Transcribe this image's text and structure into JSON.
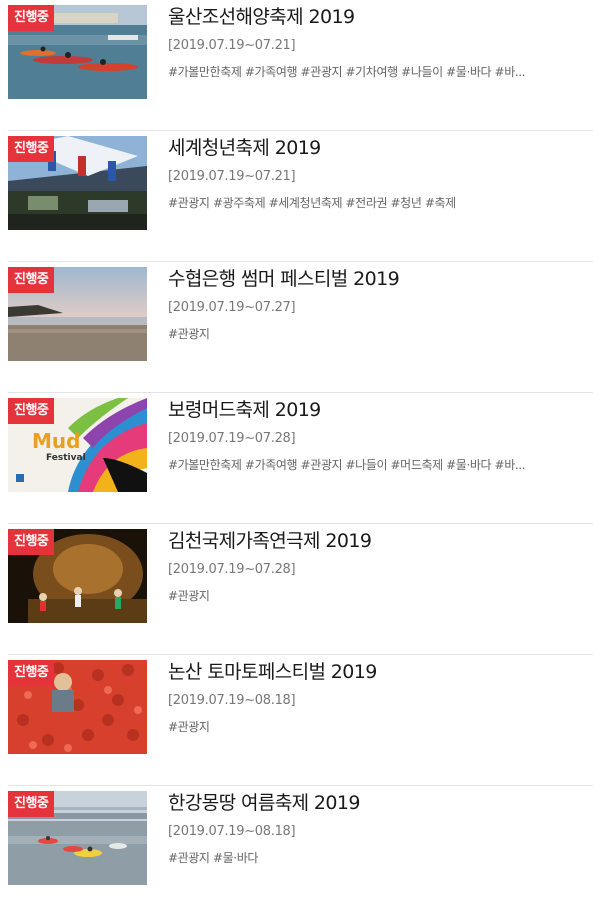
{
  "badge_label": "진행중",
  "items": [
    {
      "title": "울산조선해양축제 2019",
      "date": "[2019.07.19~07.21]",
      "tags": "#가볼만한축제 #가족여행 #관광지 #기차여행 #나들이 #물·바다 #바..."
    },
    {
      "title": "세계청년축제 2019",
      "date": "[2019.07.19~07.21]",
      "tags": "#관광지 #광주축제 #세계청년축제 #전라권 #청년 #축제"
    },
    {
      "title": "수협은행 썸머 페스티벌 2019",
      "date": "[2019.07.19~07.27]",
      "tags": "#관광지"
    },
    {
      "title": "보령머드축제 2019",
      "date": "[2019.07.19~07.28]",
      "tags": "#가볼만한축제 #가족여행 #관광지 #나들이 #머드축제 #물·바다 #바..."
    },
    {
      "title": "김천국제가족연극제 2019",
      "date": "[2019.07.19~07.28]",
      "tags": "#관광지"
    },
    {
      "title": "논산 토마토페스티벌 2019",
      "date": "[2019.07.19~08.18]",
      "tags": "#관광지"
    },
    {
      "title": "한강몽땅 여름축제 2019",
      "date": "[2019.07.19~08.18]",
      "tags": "#관광지 #물·바다"
    }
  ],
  "images": {
    "mud_poster_text_1": "Mud",
    "mud_poster_text_2": "Festival"
  }
}
